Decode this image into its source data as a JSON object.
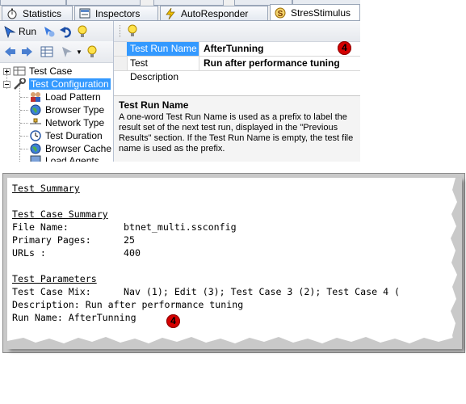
{
  "tabs": {
    "items": [
      {
        "label": "Statistics",
        "icon": "stopwatch-icon"
      },
      {
        "label": "Inspectors",
        "icon": "inspectors-icon"
      },
      {
        "label": "AutoResponder",
        "icon": "lightning-icon"
      },
      {
        "label": "StresStimulus",
        "icon": "stresstimulus-icon"
      }
    ],
    "active": "StresStimulus"
  },
  "left_toolbar": {
    "run_label": "Run"
  },
  "tree": {
    "items": [
      {
        "label": "Test Case",
        "icon": "grid-icon"
      },
      {
        "label": "Test Configuration",
        "icon": "wrench-icon"
      },
      {
        "label": "Load Pattern",
        "icon": "people-icon"
      },
      {
        "label": "Browser Type",
        "icon": "globe-icon"
      },
      {
        "label": "Network Type",
        "icon": "network-icon"
      },
      {
        "label": "Test Duration",
        "icon": "clock-icon"
      },
      {
        "label": "Browser Cache",
        "icon": "globe-icon"
      },
      {
        "label": "Load Agents",
        "icon": "agents-icon"
      }
    ]
  },
  "properties": {
    "rows": [
      {
        "name": "Test Run Name",
        "value": "AfterTunning"
      },
      {
        "name": "Test Description",
        "value": "Run after performance tuning"
      }
    ],
    "help_title": "Test Run Name",
    "help_text": "A one-word Test Run Name is used as a prefix to label the result set of the next test run, displayed in the \"Previous Results\" section. If the Test Run Name is empty, the test file name is used as the prefix."
  },
  "callout_number": "4",
  "report": {
    "summary_heading": "Test Summary",
    "case_heading": "Test Case Summary",
    "file_label": "File Name:",
    "file_value": "btnet_multi.ssconfig",
    "pages_label": "Primary Pages:",
    "pages_value": "25",
    "urls_label": "URLs :",
    "urls_value": "400",
    "params_heading": "Test Parameters",
    "mix_label": "Test Case Mix:",
    "mix_value": "Nav (1); Edit (3); Test Case 3 (2); Test Case 4 (",
    "description_line": "Description: Run after performance tuning",
    "run_name_line": "Run Name: AfterTunning"
  },
  "colors": {
    "selection": "#3399ff",
    "callout": "#d40000"
  }
}
